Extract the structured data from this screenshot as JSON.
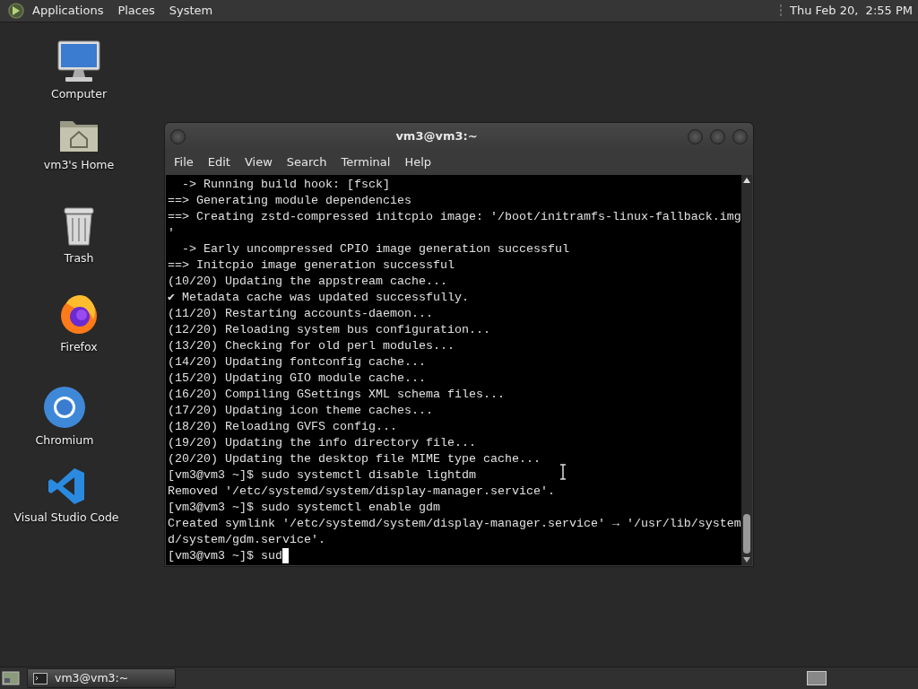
{
  "top_panel": {
    "menus": [
      "Applications",
      "Places",
      "System"
    ],
    "clock": "Thu Feb 20,  2:55 PM"
  },
  "desktop_icons": [
    {
      "label": "Computer",
      "kind": "computer"
    },
    {
      "label": "vm3's Home",
      "kind": "home"
    },
    {
      "label": "Trash",
      "kind": "trash"
    },
    {
      "label": "Firefox",
      "kind": "firefox"
    },
    {
      "label": "Chromium",
      "kind": "chromium"
    },
    {
      "label": "Visual Studio Code",
      "kind": "vscode"
    }
  ],
  "terminal": {
    "title": "vm3@vm3:~",
    "menu": [
      "File",
      "Edit",
      "View",
      "Search",
      "Terminal",
      "Help"
    ],
    "lines": [
      "  -> Running build hook: [fsck]",
      "==> Generating module dependencies",
      "==> Creating zstd-compressed initcpio image: '/boot/initramfs-linux-fallback.img",
      "'",
      "  -> Early uncompressed CPIO image generation successful",
      "==> Initcpio image generation successful",
      "(10/20) Updating the appstream cache...",
      "✔ Metadata cache was updated successfully.",
      "(11/20) Restarting accounts-daemon...",
      "(12/20) Reloading system bus configuration...",
      "(13/20) Checking for old perl modules...",
      "(14/20) Updating fontconfig cache...",
      "(15/20) Updating GIO module cache...",
      "(16/20) Compiling GSettings XML schema files...",
      "(17/20) Updating icon theme caches...",
      "(18/20) Reloading GVFS config...",
      "(19/20) Updating the info directory file...",
      "(20/20) Updating the desktop file MIME type cache...",
      "[vm3@vm3 ~]$ sudo systemctl disable lightdm",
      "Removed '/etc/systemd/system/display-manager.service'.",
      "[vm3@vm3 ~]$ sudo systemctl enable gdm",
      "Created symlink '/etc/systemd/system/display-manager.service' → '/usr/lib/system",
      "d/system/gdm.service'.",
      "[vm3@vm3 ~]$ sud"
    ]
  },
  "taskbar": {
    "tasks": [
      {
        "label": "vm3@vm3:~",
        "selected": true
      }
    ]
  }
}
